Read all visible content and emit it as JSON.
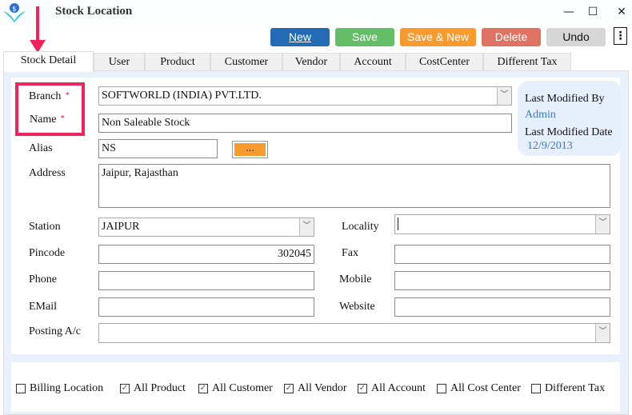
{
  "window": {
    "title": "Stock Location",
    "logo": "softworld-logo"
  },
  "toolbar": {
    "buttons": [
      {
        "label": "New",
        "color": "#246bb5"
      },
      {
        "label": "Save",
        "color": "#63be66"
      },
      {
        "label": "Save & New",
        "color": "#f99a2e"
      },
      {
        "label": "Delete",
        "color": "#e07264"
      },
      {
        "label": "Undo",
        "color": "#d6d6d6"
      }
    ]
  },
  "tabs": [
    "Stock Detail",
    "User",
    "Product",
    "Customer",
    "Vendor",
    "Account",
    "CostCenter",
    "Different Tax"
  ],
  "form": {
    "branch_label": "Branch",
    "branch_value": "SOFTWORLD (INDIA) PVT.LTD.",
    "name_label": "Name",
    "name_value": "Non Saleable Stock",
    "required_mark": "*",
    "alias_label": "Alias",
    "alias_value": "NS",
    "alias_button": "...",
    "address_label": "Address",
    "address_value": "Jaipur, Rajasthan",
    "station_label": "Station",
    "station_value": "JAIPUR",
    "locality_label": "Locality",
    "locality_value": "",
    "pincode_label": "Pincode",
    "pincode_value": "302045",
    "fax_label": "Fax",
    "fax_value": "",
    "phone_label": "Phone",
    "phone_value": "",
    "mobile_label": "Mobile",
    "mobile_value": "",
    "email_label": "EMail",
    "email_value": "",
    "website_label": "Website",
    "website_value": "",
    "posting_label": "Posting A/c",
    "posting_value": ""
  },
  "info": {
    "modified_by_label": "Last Modified By",
    "modified_by": "Admin",
    "modified_date_label": "Last Modified Date",
    "modified_date": "12/9/2013"
  },
  "checkboxes": [
    {
      "label": "Billing Location",
      "checked": false
    },
    {
      "label": "All Product",
      "checked": true
    },
    {
      "label": "All Customer",
      "checked": true
    },
    {
      "label": "All Vendor",
      "checked": true
    },
    {
      "label": "All Account",
      "checked": true
    },
    {
      "label": "All Cost Center",
      "checked": false
    },
    {
      "label": "Different Tax",
      "checked": false
    }
  ],
  "annotation_color": "#f0245a"
}
